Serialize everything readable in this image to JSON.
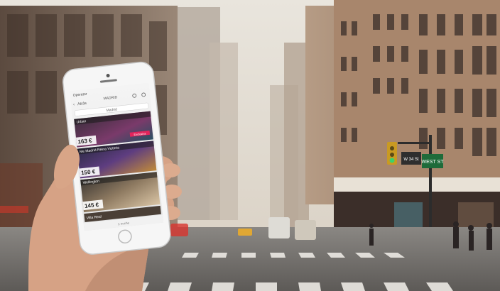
{
  "phone": {
    "status_bar": {
      "carrier": "Operator"
    },
    "nav": {
      "back_label": "Atrás",
      "city": "MADRID"
    },
    "search_city": "Madrid",
    "hotels": [
      {
        "name": "Urban",
        "price": "163 €",
        "badge": "Exclusiva"
      },
      {
        "name": "Me Madrid Reina Victoria",
        "price": "150 €"
      },
      {
        "name": "Wellington",
        "price": "145 €"
      },
      {
        "name": "Villa Real"
      }
    ],
    "footer_text": "1 noche"
  },
  "scene": {
    "street_signs": [
      "WEST ST",
      "W 34 St"
    ]
  }
}
